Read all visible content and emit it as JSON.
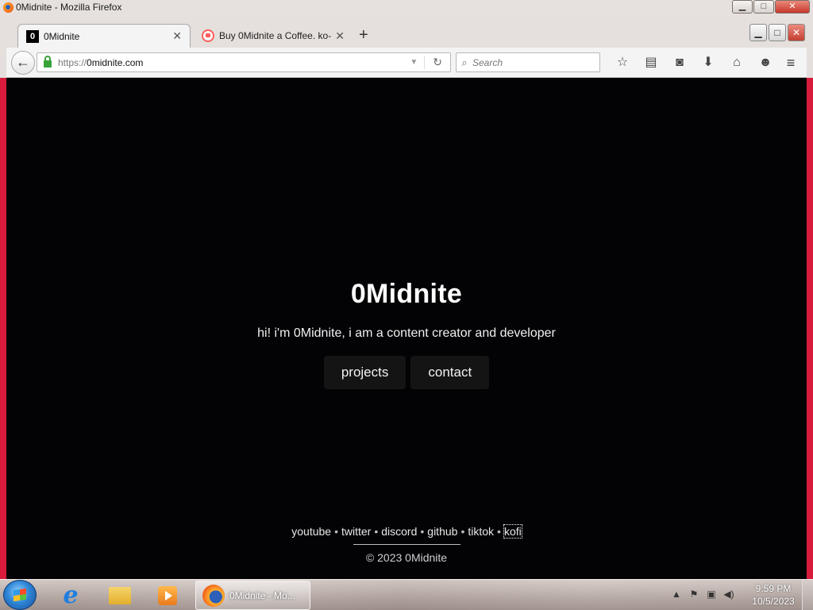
{
  "window": {
    "title": "0Midnite - Mozilla Firefox",
    "controls": {
      "minimize": "▁",
      "maximize": "□",
      "close": "✕"
    }
  },
  "tabs": [
    {
      "label": "0Midnite",
      "favicon": "0",
      "close": "✕"
    },
    {
      "label": "Buy 0Midnite a Coffee. ko-...",
      "close": "✕"
    }
  ],
  "new_tab": "+",
  "navbar": {
    "back": "←",
    "url_scheme": "https://",
    "url_host": "0midnite.com",
    "dropdown": "▼",
    "reload": "↻",
    "search_placeholder": "Search",
    "icons": [
      "star-icon",
      "reading-list-icon",
      "pocket-icon",
      "download-icon",
      "home-icon",
      "chat-icon"
    ],
    "icon_glyphs": [
      "☆",
      "▤",
      "◙",
      "⬇",
      "⌂",
      "☻"
    ],
    "menu": "≡"
  },
  "page": {
    "title": "0Midnite",
    "subtitle": "hi! i'm 0Midnite, i am a content creator and developer",
    "buttons": [
      "projects",
      "contact"
    ],
    "footer_links": [
      "youtube",
      "twitter",
      "discord",
      "github",
      "tiktok",
      "kofi"
    ],
    "separator": "•",
    "copyright": "© 2023 0Midnite"
  },
  "taskbar": {
    "firefox_label": "0Midnite - Mo...",
    "time": "9:59 PM",
    "date": "10/5/2023",
    "tray_glyphs": [
      "▲",
      "⚑",
      "▣",
      "◀)"
    ]
  },
  "colors": {
    "page_bg": "#030306",
    "frame_accent": "#d81b3a",
    "lock_green": "#39a33a"
  }
}
